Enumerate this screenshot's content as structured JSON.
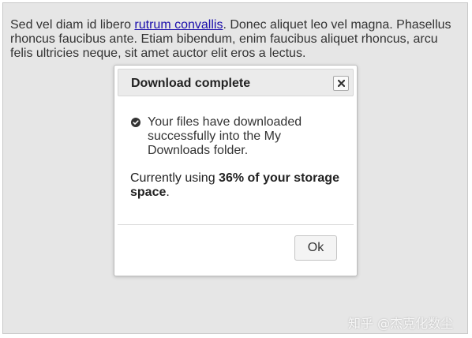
{
  "background": {
    "text_before_link": "Sed vel diam id libero ",
    "link_text": "rutrum convallis",
    "text_after_link": ". Donec aliquet leo vel magna. Phasellus rhoncus faucibus ante. Etiam bibendum, enim faucibus aliquet rhoncus, arcu felis ultricies neque, sit amet auctor elit eros a lectus."
  },
  "dialog": {
    "title": "Download complete",
    "close_icon": "close-icon",
    "message_icon": "check-circle-icon",
    "message": "Your files have downloaded successfully into the My Downloads folder.",
    "storage_prefix": "Currently using ",
    "storage_value": "36% of your storage space",
    "storage_suffix": ".",
    "ok_label": "Ok"
  },
  "watermark": "知乎 @杰克化数尘",
  "colors": {
    "page_background": "#e6e6e6",
    "dialog_background": "#ffffff",
    "header_background": "#ebebeb",
    "link": "#1a0dab",
    "text": "#333333"
  }
}
